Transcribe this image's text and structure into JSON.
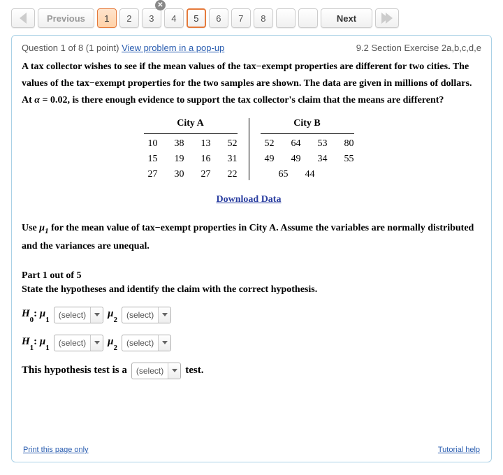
{
  "pager": {
    "prev_label": "Previous",
    "next_label": "Next",
    "pages": [
      "1",
      "2",
      "3",
      "4",
      "5",
      "6",
      "7",
      "8"
    ],
    "current": 1,
    "highlighted": 5
  },
  "header": {
    "q_counter": "Question 1 of 8 (1 point) ",
    "popup_link": "View problem in a pop-up",
    "section_ref": "9.2 Section Exercise 2a,b,c,d,e"
  },
  "question": {
    "text_before_alpha": "A tax collector wishes to see if the mean values of the tax−exempt properties are different for two cities. The values of the tax−exempt properties for the two samples are shown. The data are given in millions of dollars. At ",
    "alpha_sym": "α",
    "alpha_eq": " = 0.02",
    "text_after_alpha": ", is there enough evidence to support the tax collector's claim that the means are different?"
  },
  "table": {
    "cityA_label": "City A",
    "cityB_label": "City B",
    "cityA": [
      [
        "10",
        "38",
        "13",
        "52"
      ],
      [
        "15",
        "19",
        "16",
        "31"
      ],
      [
        "27",
        "30",
        "27",
        "22"
      ]
    ],
    "cityB": [
      [
        "52",
        "64",
        "53",
        "80"
      ],
      [
        "49",
        "49",
        "34",
        "55"
      ],
      [
        "65",
        "44",
        "",
        ""
      ]
    ]
  },
  "download_label": "Download Data",
  "instr": {
    "before_mu": "Use ",
    "mu": "μ",
    "sub1": "1",
    "after_mu": " for the mean value of tax−exempt properties in City A. Assume the variables are normally distributed and the variances are unequal."
  },
  "part": {
    "label": "Part 1 out of 5",
    "text": "State the hypotheses and identify the claim with the correct hypothesis."
  },
  "hyp": {
    "H0": "H",
    "H1": "H",
    "sub0": "0",
    "sub1_h": "1",
    "colon": ": ",
    "mu": "μ",
    "s1": "1",
    "s2": "2",
    "select_label": "(select)"
  },
  "tail": {
    "before": "This hypothesis test is a ",
    "select_label": "(select)",
    "after": " test."
  },
  "footer": {
    "print": "Print this page only",
    "tutorial": "Tutorial help"
  }
}
